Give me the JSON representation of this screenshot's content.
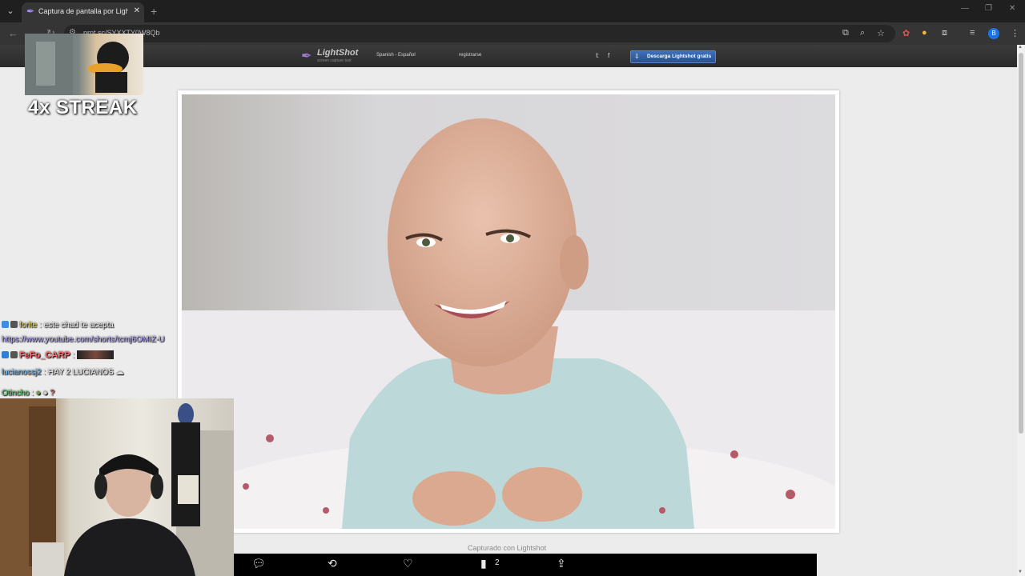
{
  "browser": {
    "tab_title": "Captura de pantalla por Lightshot",
    "tab_close": "✕",
    "new_tab": "+",
    "url": "prnt.sc/SYXXTY0W8Qb",
    "window_controls": [
      "—",
      "❐",
      "✕"
    ]
  },
  "lightshot": {
    "logo_name": "LightShot",
    "logo_tagline": "screen capture tool",
    "language": "Spanish - Español",
    "register": "registrarse",
    "download_label": "Descarga Lightshot gratis",
    "caption": "Capturado con Lightshot"
  },
  "stream": {
    "streak_text": "4x STREAK",
    "chat": [
      {
        "user": "forite",
        "sep": " : ",
        "message": "este chad te acepta"
      },
      {
        "user": "",
        "sep": "",
        "message": "https://www.youtube.com/shorts/tcmj6OMIZ-U"
      },
      {
        "user": "FeFo_CARP",
        "sep": " : ",
        "message": ""
      },
      {
        "user": "lucianossj2",
        "sep": " : ",
        "message": "HAY 2 LUCIANOS"
      },
      {
        "user": "Otincho",
        "sep": " : ",
        "message": ""
      }
    ]
  },
  "action_bar": {
    "views_count": "2"
  },
  "icons": {
    "tab_menu": "chevron-down-icon",
    "favicon": "feather-icon",
    "back": "arrow-left-icon",
    "forward": "arrow-right-icon",
    "reload": "reload-icon",
    "twitter": "twitter-icon",
    "facebook": "facebook-icon",
    "reply": "comment-icon",
    "retweet": "retweet-icon",
    "like": "heart-icon",
    "views": "bar-chart-icon",
    "share": "share-icon"
  },
  "colors": {
    "accent": "#1a73e8",
    "download_button": "#3e6fb8",
    "page_bg": "#ececec"
  }
}
